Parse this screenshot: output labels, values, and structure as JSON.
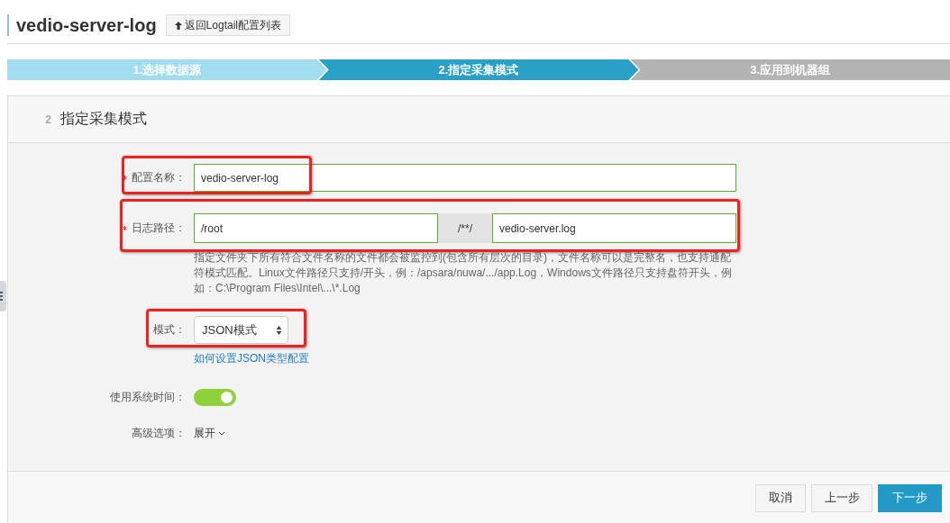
{
  "header": {
    "title": "vedio-server-log",
    "back_button": "返回Logtail配置列表"
  },
  "steps": [
    {
      "label": "1.选择数据源",
      "completed": true,
      "selected": false
    },
    {
      "label": "2.指定采集模式",
      "completed": false,
      "selected": true
    },
    {
      "label": "3.应用到机器组",
      "completed": false,
      "selected": false
    }
  ],
  "panel": {
    "step_number": "2",
    "title": "指定采集模式",
    "fields": [
      {
        "kind": "text",
        "label": "配置名称：",
        "required": true,
        "highlighted": true,
        "value": "vedio-server-log"
      },
      {
        "kind": "path",
        "label": "日志路径：",
        "required": true,
        "highlighted": true,
        "directory": "/root",
        "separator": "/**/",
        "file_name": "vedio-server.log",
        "help": "指定文件夹下所有符合文件名称的文件都会被监控到(包含所有层次的目录)，文件名称可以是完整名，也支持通配符模式匹配。Linux文件路径只支持/开头，例：/apsara/nuwa/.../app.Log，Windows文件路径只支持盘符开头，例如：C:\\Program Files\\Intel\\...\\*.Log"
      },
      {
        "kind": "select",
        "label": "模式：",
        "highlighted": true,
        "value": "JSON模式",
        "link": "如何设置JSON类型配置"
      },
      {
        "kind": "switch",
        "label": "使用系统时间：",
        "on": true
      },
      {
        "kind": "expander",
        "label": "高级选项：",
        "value": "展开",
        "expanded": false
      }
    ]
  },
  "buttons": [
    {
      "label": "取消",
      "kind": "default"
    },
    {
      "label": "上一步",
      "kind": "default"
    },
    {
      "label": "下一步",
      "kind": "primary"
    }
  ]
}
